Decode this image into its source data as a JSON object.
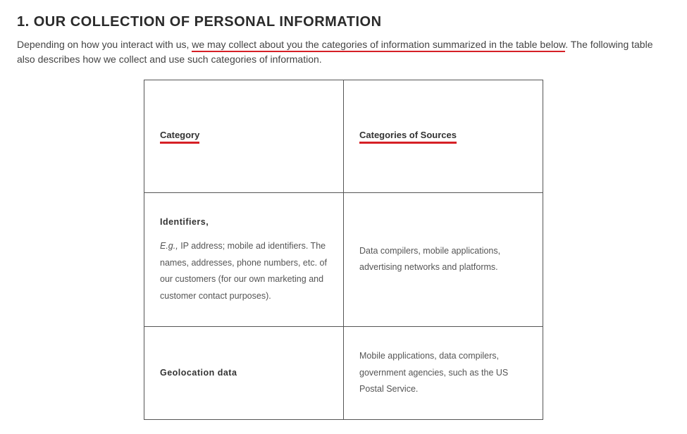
{
  "heading": "1. OUR COLLECTION OF PERSONAL INFORMATION",
  "intro": {
    "prefix": "Depending on how you interact with us, ",
    "underlined": "we may collect about you the categories of information summarized in the table below",
    "suffix": ". The following table also describes how we collect and use such categories of information."
  },
  "table": {
    "headers": {
      "col1": "Category",
      "col2": "Categories of Sources"
    },
    "rows": [
      {
        "title": "Identifiers,",
        "eg_label": "E.g.,",
        "eg_rest": " IP address; mobile ad identifiers. The names, addresses, phone numbers, etc. of our customers (for our own marketing and customer contact purposes).",
        "sources": "Data compilers, mobile applications, advertising networks and platforms."
      },
      {
        "title": "Geolocation  data",
        "sources": "Mobile applications, data compilers, government agencies, such as the US Postal Service."
      }
    ]
  }
}
